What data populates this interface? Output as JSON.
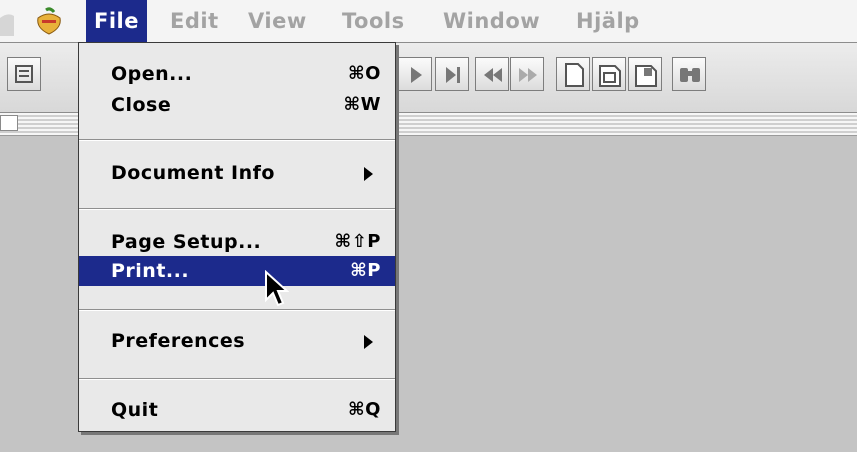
{
  "menubar": {
    "items": [
      {
        "label": "File",
        "active": true
      },
      {
        "label": "Edit"
      },
      {
        "label": "View"
      },
      {
        "label": "Tools"
      },
      {
        "label": "Window"
      },
      {
        "label": "Hjälp"
      }
    ]
  },
  "file_menu": {
    "items": [
      {
        "label": "Open...",
        "shortcut": "⌘O"
      },
      {
        "label": "Close",
        "shortcut": "⌘W"
      },
      {
        "label": "Document Info",
        "submenu": true
      },
      {
        "label": "Page Setup...",
        "shortcut": "⌘⇧P"
      },
      {
        "label": "Print...",
        "shortcut": "⌘P",
        "highlighted": true
      },
      {
        "label": "Preferences",
        "submenu": true
      },
      {
        "label": "Quit",
        "shortcut": "⌘Q"
      }
    ]
  },
  "toolbar": {
    "buttons": [
      "page-view-icon",
      "play-icon",
      "skip-to-end-icon",
      "rewind-icon",
      "fast-forward-icon",
      "single-page-icon",
      "continuous-page-icon",
      "facing-pages-icon",
      "find-binoculars-icon"
    ]
  },
  "colors": {
    "highlight": "#1c2a8c",
    "menubar_bg": "#f4f4f4",
    "content_bg": "#c4c4c4"
  }
}
